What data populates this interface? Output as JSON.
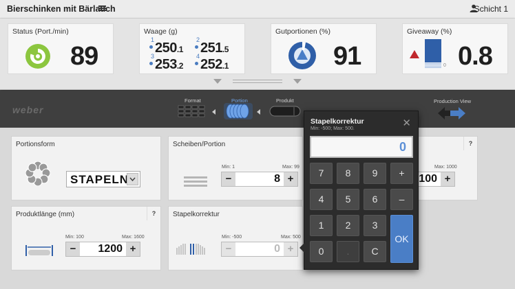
{
  "header": {
    "title": "Bierschinken mit Bärlauch",
    "shift": "Schicht 1"
  },
  "kpis": {
    "status": {
      "title": "Status (Port./min)",
      "value": "89"
    },
    "scale": {
      "title": "Waage (g)",
      "items": [
        {
          "idx": "1",
          "int": "250",
          "dec": ".1"
        },
        {
          "idx": "2",
          "int": "251",
          "dec": ".5"
        },
        {
          "idx": "3",
          "int": "253",
          "dec": ".2"
        },
        {
          "idx": "4",
          "int": "252",
          "dec": ".1"
        }
      ]
    },
    "good": {
      "title": "Gutportionen (%)",
      "value": "91"
    },
    "giveaway": {
      "title": "Giveaway (%)",
      "value": "0.8",
      "axis_zero": "0"
    }
  },
  "nav": {
    "steps": [
      {
        "label": "Format"
      },
      {
        "label": "Portion"
      },
      {
        "label": "Produkt"
      }
    ],
    "active_step": "Portion",
    "production_view": "Production View",
    "logo": "weber"
  },
  "cards": {
    "portion_shape": {
      "title": "Portionsform",
      "value": "STAPELN"
    },
    "slices": {
      "title": "Scheiben/Portion",
      "min": "Min: 1",
      "max": "Max: 99",
      "value": "8"
    },
    "right_card": {
      "max": "Max: 1000",
      "value": "100",
      "help": "?"
    },
    "product_length": {
      "title": "Produktlänge (mm)",
      "min": "Min: 100",
      "max": "Max: 1600",
      "value": "1200",
      "help": "?"
    },
    "stack_correction": {
      "title": "Stapelkorrektur",
      "min": "Min: -500",
      "max": "Max: 500",
      "value": "0"
    }
  },
  "keypad": {
    "title": "Stapelkorrektur",
    "subtitle": "Min: -500; Max: 500.",
    "display": "0",
    "keys": [
      "7",
      "8",
      "9",
      "+",
      "4",
      "5",
      "6",
      "–",
      "1",
      "2",
      "3",
      "0",
      ".",
      "C"
    ],
    "ok": "OK",
    "close": "✕"
  },
  "colors": {
    "accent": "#4a7ec6",
    "status_green": "#8cc63f",
    "warning_red": "#c0282d"
  }
}
